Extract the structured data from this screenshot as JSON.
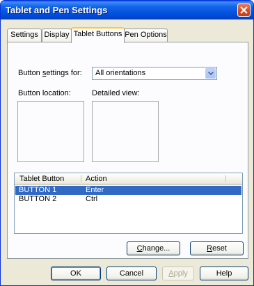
{
  "window": {
    "title": "Tablet and Pen Settings"
  },
  "tabs": [
    {
      "label": "Settings"
    },
    {
      "label": "Display"
    },
    {
      "label": "Tablet Buttons"
    },
    {
      "label": "Pen Options"
    }
  ],
  "button_settings": {
    "label_pre": "Button ",
    "label_ul": "s",
    "label_post": "ettings for:",
    "selected": "All orientations"
  },
  "button_location_label": "Button location:",
  "detailed_view_label": "Detailed view:",
  "list": {
    "columns": [
      "Tablet Button",
      "Action"
    ],
    "rows": [
      {
        "button": "BUTTON 1",
        "action": "Enter",
        "selected": true
      },
      {
        "button": "BUTTON 2",
        "action": "Ctrl",
        "selected": false
      }
    ]
  },
  "buttons": {
    "change_ul": "C",
    "change_rest": "hange...",
    "reset_ul": "R",
    "reset_rest": "eset",
    "ok": "OK",
    "cancel": "Cancel",
    "apply_ul": "A",
    "apply_rest": "pply",
    "help": "Help"
  },
  "colors": {
    "title_bar": "#0252e0",
    "selection": "#316ac5",
    "active_tab_accent": "#ffc83c"
  }
}
